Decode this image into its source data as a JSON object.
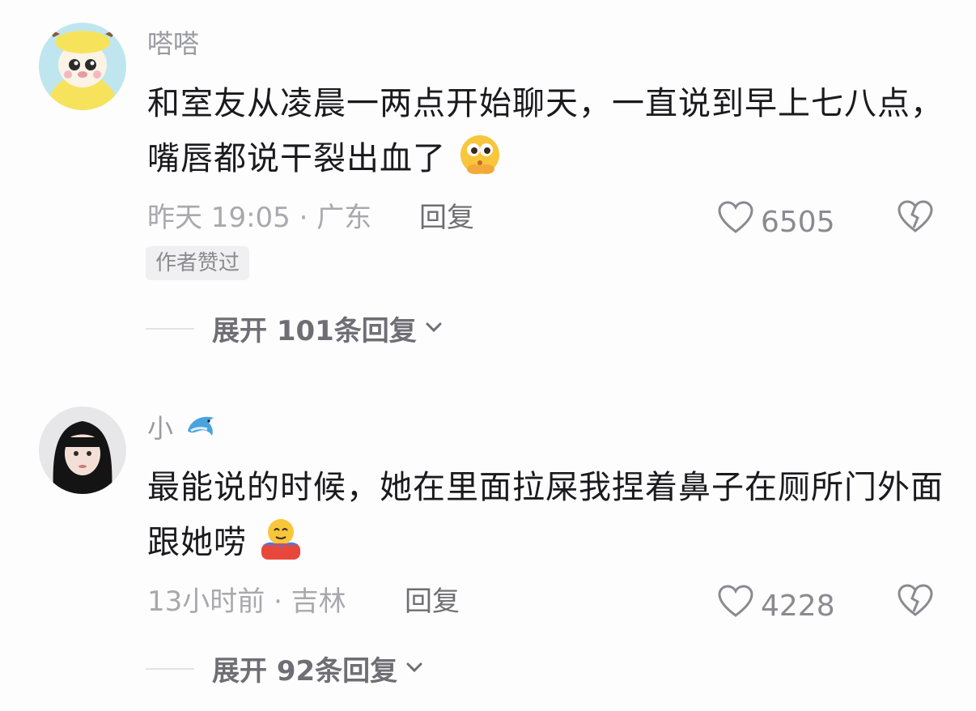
{
  "comments": [
    {
      "username": "嗒嗒",
      "text": "和室友从凌晨一两点开始聊天，一直说到早上七八点，嘴唇都说干裂出血了",
      "emoji_icon": "thinking-face-emoji-icon",
      "time_location": "昨天 19:05 · 广东",
      "reply_label": "回复",
      "likes": "6505",
      "badge": "作者赞过",
      "expand_label": "展开 101条回复"
    },
    {
      "username": "小",
      "username_emoji_icon": "dolphin-icon",
      "text": "最能说的时候，她在里面拉屎我捏着鼻子在厕所门外面跟她唠",
      "emoji_icon": "hug-emoji-icon",
      "time_location": "13小时前 · 吉林",
      "reply_label": "回复",
      "likes": "4228",
      "expand_label": "展开 92条回复"
    }
  ],
  "colors": {
    "background": "#fdfdfd",
    "text": "#1a1a1e",
    "muted": "#a8a8ae",
    "badge_bg": "#f0f0f2"
  }
}
